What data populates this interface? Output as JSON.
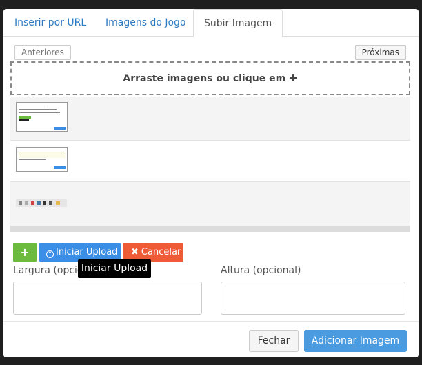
{
  "tabs": [
    {
      "label": "Inserir por URL",
      "active": false
    },
    {
      "label": "Imagens do Jogo",
      "active": false
    },
    {
      "label": "Subir Imagem",
      "active": true
    }
  ],
  "pager": {
    "prev_label": "Anteriores",
    "next_label": "Próximas"
  },
  "dropzone": {
    "text": "Arraste imagens ou clique em",
    "icon": "plus-icon"
  },
  "files": [
    {
      "thumb": "screenshot-thumbnail"
    },
    {
      "thumb": "dialog-thumbnail"
    },
    {
      "thumb": "icon-strip-thumbnail"
    }
  ],
  "actions": {
    "add_icon": "+",
    "upload_label": "Iniciar Upload",
    "cancel_label": "Cancelar",
    "cancel_icon": "✖"
  },
  "tooltip": {
    "text": "Iniciar Upload"
  },
  "fields": {
    "width_label": "Largura (opcional)",
    "height_label": "Altura (opcional)",
    "width_value": "",
    "height_value": ""
  },
  "footer": {
    "close_label": "Fechar",
    "submit_label": "Adicionar Imagem"
  },
  "colors": {
    "link": "#2f7bc2",
    "add": "#6cba3e",
    "upload": "#3a8ee6",
    "cancel": "#ef5a37",
    "primary": "#4a9be0"
  }
}
